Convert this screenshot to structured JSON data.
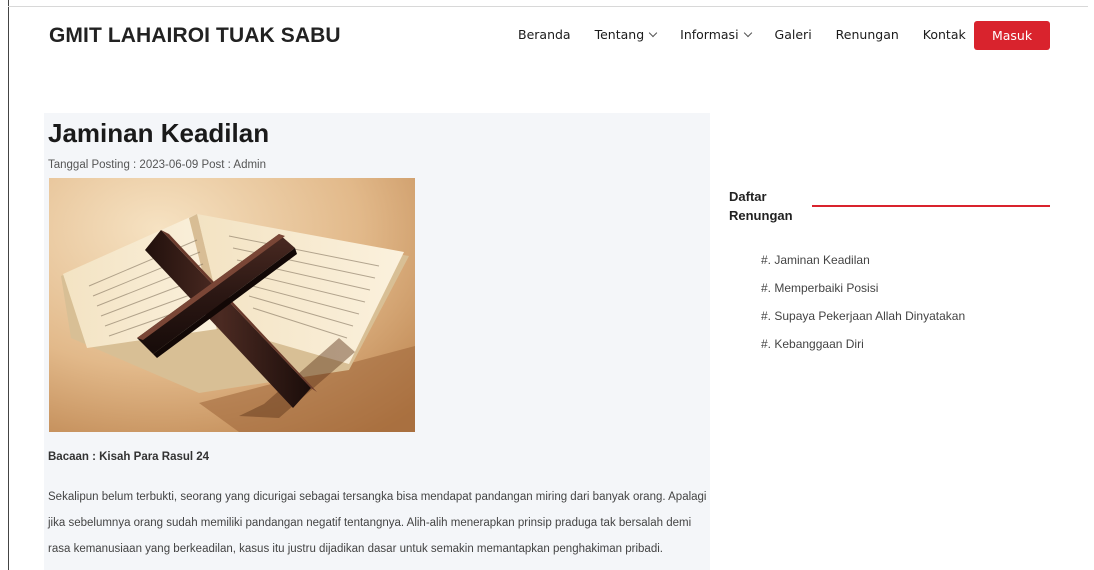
{
  "header": {
    "brand": "GMIT LAHAIROI TUAK SABU",
    "nav": [
      {
        "label": "Beranda",
        "has_dropdown": false
      },
      {
        "label": "Tentang",
        "has_dropdown": true
      },
      {
        "label": "Informasi",
        "has_dropdown": true
      },
      {
        "label": "Galeri",
        "has_dropdown": false
      },
      {
        "label": "Renungan",
        "has_dropdown": false
      },
      {
        "label": "Kontak",
        "has_dropdown": false
      }
    ],
    "login_label": "Masuk"
  },
  "article": {
    "title": "Jaminan Keadilan",
    "meta": "Tanggal Posting : 2023-06-09 Post : Admin",
    "reading": "Bacaan : Kisah Para Rasul 24",
    "body": "Sekalipun belum terbukti, seorang yang dicurigai sebagai tersangka bisa mendapat pandangan miring dari banyak orang. Apalagi jika sebelumnya orang sudah memiliki pandangan negatif tentangnya. Alih-alih menerapkan prinsip praduga tak bersalah demi rasa kemanusiaan yang berkeadilan, kasus itu justru dijadikan dasar untuk semakin memantapkan penghakiman pribadi."
  },
  "sidebar": {
    "title": "Daftar Renungan",
    "items": [
      "#. Jaminan Keadilan",
      "#. Memperbaiki Posisi",
      "#. Supaya Pekerjaan Allah Dinyatakan",
      "#. Kebanggaan Diri"
    ]
  },
  "colors": {
    "accent": "#d9232d",
    "article_background": "#f4f6f9"
  }
}
